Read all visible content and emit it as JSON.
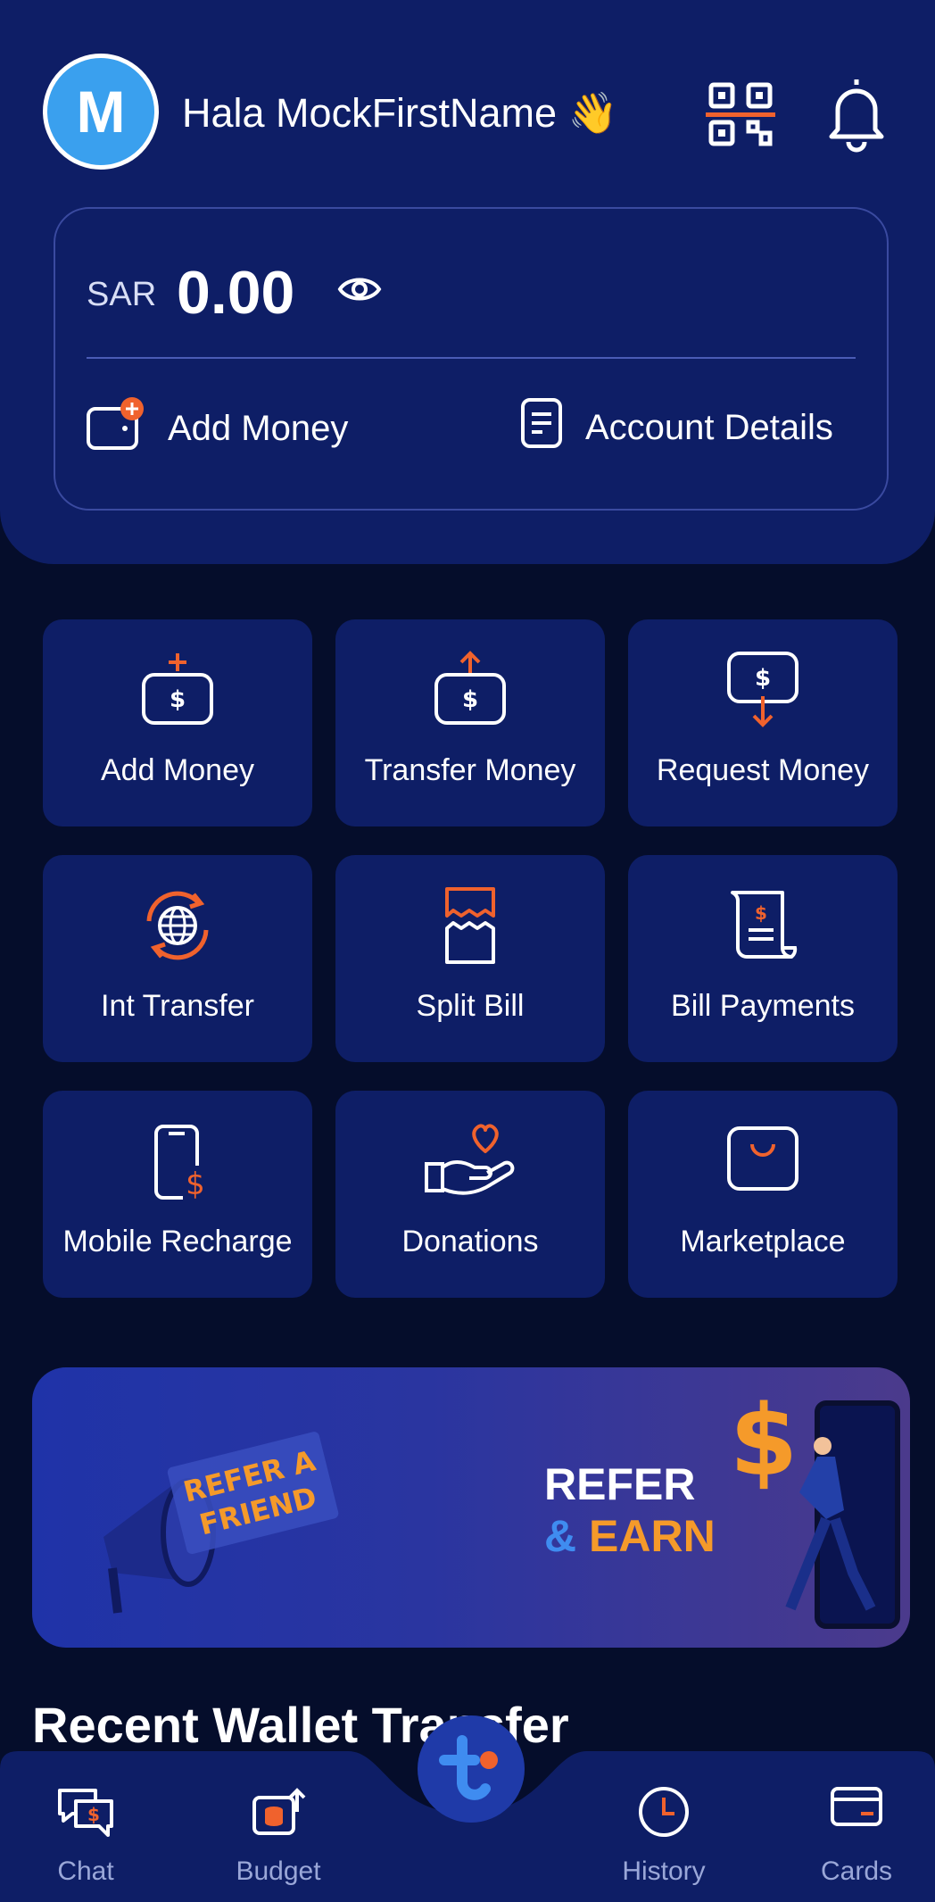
{
  "header": {
    "avatar_initial": "M",
    "greeting": "Hala MockFirstName 👋",
    "qr_icon": "qr-scan-icon",
    "bell_icon": "bell-icon"
  },
  "balance": {
    "currency": "SAR",
    "amount": "0.00",
    "add_money_label": "Add Money",
    "account_details_label": "Account Details"
  },
  "actions": [
    {
      "label": "Add Money",
      "icon": "add-money-icon"
    },
    {
      "label": "Transfer Money",
      "icon": "transfer-money-icon"
    },
    {
      "label": "Request Money",
      "icon": "request-money-icon"
    },
    {
      "label": "Int Transfer",
      "icon": "globe-transfer-icon"
    },
    {
      "label": "Split Bill",
      "icon": "split-bill-icon"
    },
    {
      "label": "Bill Payments",
      "icon": "bill-scroll-icon"
    },
    {
      "label": "Mobile Recharge",
      "icon": "mobile-recharge-icon"
    },
    {
      "label": "Donations",
      "icon": "donation-hand-icon"
    },
    {
      "label": "Marketplace",
      "icon": "shopping-bag-icon"
    }
  ],
  "banner": {
    "megaphone_line1": "REFER A",
    "megaphone_line2": "FRIEND",
    "title_line1": "REFER",
    "title_amp": "&",
    "title_earn": "EARN"
  },
  "section_title": "Recent Wallet Transfer",
  "nav": [
    {
      "label": "Chat",
      "icon": "chat-icon"
    },
    {
      "label": "Budget",
      "icon": "budget-icon"
    },
    {
      "label": "History",
      "icon": "clock-icon"
    },
    {
      "label": "Cards",
      "icon": "card-icon"
    }
  ],
  "colors": {
    "primary_navy": "#0e1e66",
    "background": "#050d2b",
    "accent_orange": "#f0622d",
    "avatar_blue": "#3aa0ee"
  }
}
